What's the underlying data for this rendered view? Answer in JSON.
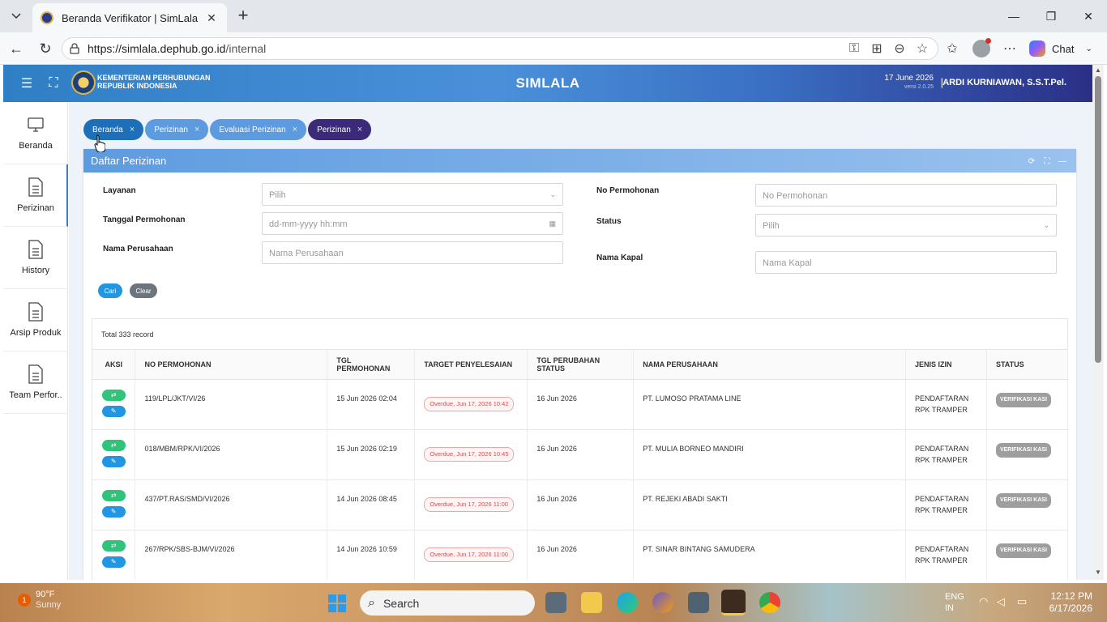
{
  "browser": {
    "tab_title": "Beranda Verifikator | SimLala",
    "url_host": "https://simlala.dephub.go.id",
    "url_path": "/internal",
    "chat_label": "Chat"
  },
  "header": {
    "org_line1": "KEMENTERIAN PERHUBUNGAN",
    "org_line2": "REPUBLIK INDONESIA",
    "app_title": "SIMLALA",
    "date": "17 June 2026",
    "version": "versi 2.0.25",
    "separator": "|",
    "user": "ARDI KURNIAWAN, S.S.T.Pel."
  },
  "sidebar": {
    "items": [
      {
        "label": "Beranda",
        "icon": "monitor-icon"
      },
      {
        "label": "Perizinan",
        "icon": "document-icon"
      },
      {
        "label": "History",
        "icon": "document-icon"
      },
      {
        "label": "Arsip Produk",
        "icon": "document-icon"
      },
      {
        "label": "Team Perfor..",
        "icon": "document-icon"
      }
    ]
  },
  "page_tabs": [
    {
      "label": "Beranda",
      "close": "×"
    },
    {
      "label": "Perizinan",
      "close": "×"
    },
    {
      "label": "Evaluasi Perizinan",
      "close": "×"
    },
    {
      "label": "Perizinan",
      "close": "×"
    }
  ],
  "panel": {
    "title": "Daftar Perizinan"
  },
  "filters": {
    "layanan_label": "Layanan",
    "layanan_value": "Pilih",
    "tanggal_label": "Tanggal Permohonan",
    "tanggal_placeholder": "dd-mm-yyyy hh:mm",
    "nama_perusahaan_label": "Nama Perusahaan",
    "nama_perusahaan_placeholder": "Nama Perusahaan",
    "no_permohonan_label": "No Permohonan",
    "no_permohonan_placeholder": "No Permohonan",
    "status_label": "Status",
    "status_value": "Pilih",
    "nama_kapal_label": "Nama Kapal",
    "nama_kapal_placeholder": "Nama Kapal",
    "cari_label": "Cari",
    "clear_label": "Clear"
  },
  "table": {
    "total": "Total 333 record",
    "headers": [
      "AKSI",
      "NO PERMOHONAN",
      "TGL PERMOHONAN",
      "TARGET PENYELESAIAN",
      "TGL PERUBAHAN STATUS",
      "NAMA PERUSAHAAN",
      "JENIS IZIN",
      "STATUS"
    ],
    "rows": [
      {
        "no": "119/LPL/JKT/VI/26",
        "tgl": "15 Jun 2026 02:04",
        "target": "Overdue, Jun 17, 2026 10:42",
        "ubah": "16 Jun 2026",
        "perusahaan": "PT. LUMOSO PRATAMA LINE",
        "izin1": "PENDAFTARAN",
        "izin2": "RPK TRAMPER",
        "status": "VERIFIKASI KASI"
      },
      {
        "no": "018/MBM/RPK/VI/2026",
        "tgl": "15 Jun 2026 02:19",
        "target": "Overdue, Jun 17, 2026 10:45",
        "ubah": "16 Jun 2026",
        "perusahaan": "PT. MULIA BORNEO MANDIRI",
        "izin1": "PENDAFTARAN",
        "izin2": "RPK TRAMPER",
        "status": "VERIFIKASI KASI"
      },
      {
        "no": "437/PT.RAS/SMD/VI/2026",
        "tgl": "14 Jun 2026 08:45",
        "target": "Overdue, Jun 17, 2026 11:00",
        "ubah": "16 Jun 2026",
        "perusahaan": "PT. REJEKI ABADI SAKTI",
        "izin1": "PENDAFTARAN",
        "izin2": "RPK TRAMPER",
        "status": "VERIFIKASI KASI"
      },
      {
        "no": "267/RPK/SBS-BJM/VI/2026",
        "tgl": "14 Jun 2026 10:59",
        "target": "Overdue, Jun 17, 2026 11:00",
        "ubah": "16 Jun 2026",
        "perusahaan": "PT. SINAR BINTANG SAMUDERA",
        "izin1": "PENDAFTARAN",
        "izin2": "RPK TRAMPER",
        "status": "VERIFIKASI KASI"
      }
    ]
  },
  "taskbar": {
    "badge": "1",
    "temp": "90°F",
    "weather": "Sunny",
    "search": "Search",
    "lang1": "ENG",
    "lang2": "IN",
    "time": "12:12 PM",
    "date": "6/17/2026"
  },
  "colors": {
    "tab_active": "#1c6fb8",
    "tab_normal": "#5d9be0",
    "tab_current": "#3b2a7a",
    "btn_cari": "#2196e3",
    "btn_clear": "#6c757d"
  }
}
